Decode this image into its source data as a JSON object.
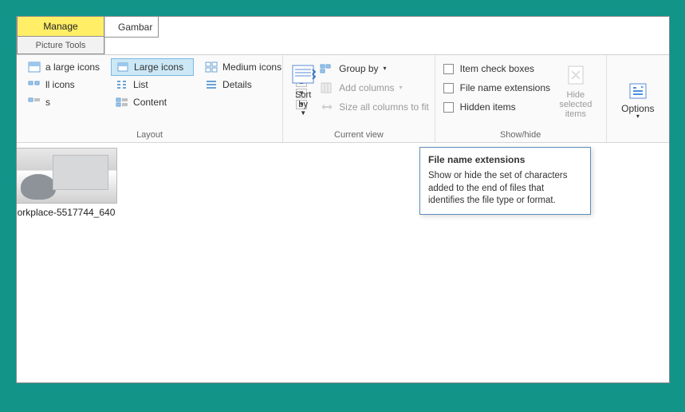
{
  "tabs": {
    "manage": "Manage",
    "picture_tools": "Picture Tools",
    "right": "Gambar"
  },
  "layout": {
    "label": "Layout",
    "col1": {
      "row1": "a large icons",
      "row2": "ll icons",
      "row3": "s"
    },
    "col2": {
      "large": "Large icons",
      "list": "List",
      "content": "Content"
    },
    "col3": {
      "medium": "Medium icons",
      "details": "Details"
    }
  },
  "current_view": {
    "label": "Current view",
    "sort_by": "Sort\nby",
    "group_by": "Group by",
    "add_columns": "Add columns",
    "size_all": "Size all columns to fit"
  },
  "show_hide": {
    "label": "Show/hide",
    "item_check": "Item check boxes",
    "file_ext": "File name extensions",
    "hidden": "Hidden items",
    "hide_selected": "Hide selected\nitems"
  },
  "options": {
    "label": "Options"
  },
  "file": {
    "name": "orkplace-5517744_640"
  },
  "tooltip": {
    "title": "File name extensions",
    "body": "Show or hide the set of characters added to the end of files that identifies the file type or format."
  }
}
